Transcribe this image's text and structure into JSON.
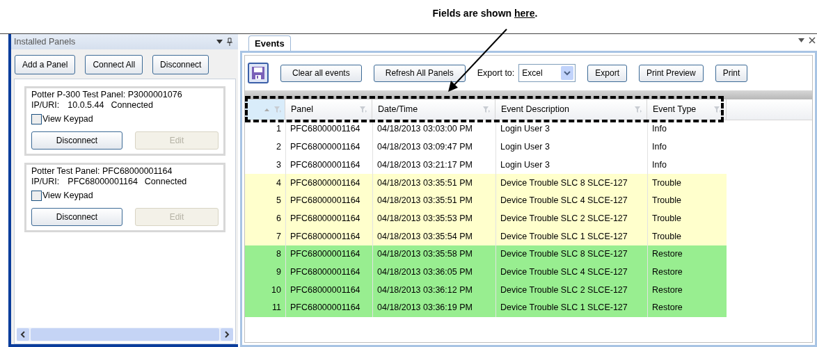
{
  "annotation": {
    "before": "Fields are shown ",
    "link": "here",
    "after": "."
  },
  "installed_panels": {
    "title": "Installed Panels",
    "buttons": [
      "Add a Panel",
      "Connect All",
      "Disconnect"
    ],
    "panels": [
      {
        "name": "Potter P-300 Test Panel: P3000001076",
        "ip_label": "IP/URI:",
        "ip": "10.0.5.44",
        "status": "Connected",
        "keypad": {
          "label": "View Keypad",
          "checked": false
        },
        "disconnect": "Disconnect",
        "edit": {
          "label": "Edit",
          "disabled": true
        }
      },
      {
        "name": "Potter Test Panel: PFC68000001164",
        "ip_label": "IP/URI:",
        "ip": "PFC68000001164",
        "status": "Connected",
        "keypad": {
          "label": "View Keypad",
          "checked": false
        },
        "disconnect": "Disconnect",
        "edit": {
          "label": "Edit",
          "disabled": true
        }
      }
    ]
  },
  "events": {
    "tab": {
      "label": "Events",
      "selected": true
    },
    "toolbar": {
      "buttons": [
        "Clear all events",
        "Refresh All Panels"
      ],
      "export_label": "Export to:",
      "export_value": "Excel",
      "more_buttons": [
        "Export",
        "Print Preview",
        "Print"
      ]
    },
    "columns": [
      "Panel",
      "Date/Time",
      "Event Description",
      "Event Type"
    ],
    "rows": [
      {
        "number": "1",
        "panel": "PFC68000001164",
        "time": "04/18/2013 03:03:00 PM",
        "description": "Login User 3",
        "type": "Info",
        "color": "#ffffff"
      },
      {
        "number": "2",
        "panel": "PFC68000001164",
        "time": "04/18/2013 03:09:47 PM",
        "description": "Login User 3",
        "type": "Info",
        "color": "#ffffff"
      },
      {
        "number": "3",
        "panel": "PFC68000001164",
        "time": "04/18/2013 03:21:17 PM",
        "description": "Login User 3",
        "type": "Info",
        "color": "#ffffff"
      },
      {
        "number": "4",
        "panel": "PFC68000001164",
        "time": "04/18/2013 03:35:51 PM",
        "description": "Device Trouble SLC 8 SLCE-127",
        "type": "Trouble",
        "color": "#ffffcc"
      },
      {
        "number": "5",
        "panel": "PFC68000001164",
        "time": "04/18/2013 03:35:51 PM",
        "description": "Device Trouble SLC 4 SLCE-127",
        "type": "Trouble",
        "color": "#ffffcc"
      },
      {
        "number": "6",
        "panel": "PFC68000001164",
        "time": "04/18/2013 03:35:53 PM",
        "description": "Device Trouble SLC 2 SLCE-127",
        "type": "Trouble",
        "color": "#ffffcc"
      },
      {
        "number": "7",
        "panel": "PFC68000001164",
        "time": "04/18/2013 03:35:54 PM",
        "description": "Device Trouble SLC 1 SLCE-127",
        "type": "Trouble",
        "color": "#ffffcc"
      },
      {
        "number": "8",
        "panel": "PFC68000001164",
        "time": "04/18/2013 03:35:58 PM",
        "description": "Device Trouble SLC 8 SLCE-127",
        "type": "Restore",
        "color": "#98ee90"
      },
      {
        "number": "9",
        "panel": "PFC68000001164",
        "time": "04/18/2013 03:36:05 PM",
        "description": "Device Trouble SLC 4 SLCE-127",
        "type": "Restore",
        "color": "#98ee90"
      },
      {
        "number": "10",
        "panel": "PFC68000001164",
        "time": "04/18/2013 03:36:12 PM",
        "description": "Device Trouble SLC 2 SLCE-127",
        "type": "Restore",
        "color": "#98ee90"
      },
      {
        "number": "11",
        "panel": "PFC68000001164",
        "time": "04/18/2013 03:36:19 PM",
        "description": "Device Trouble SLC 1 SLCE-127",
        "type": "Restore",
        "color": "#98ee90"
      }
    ]
  }
}
